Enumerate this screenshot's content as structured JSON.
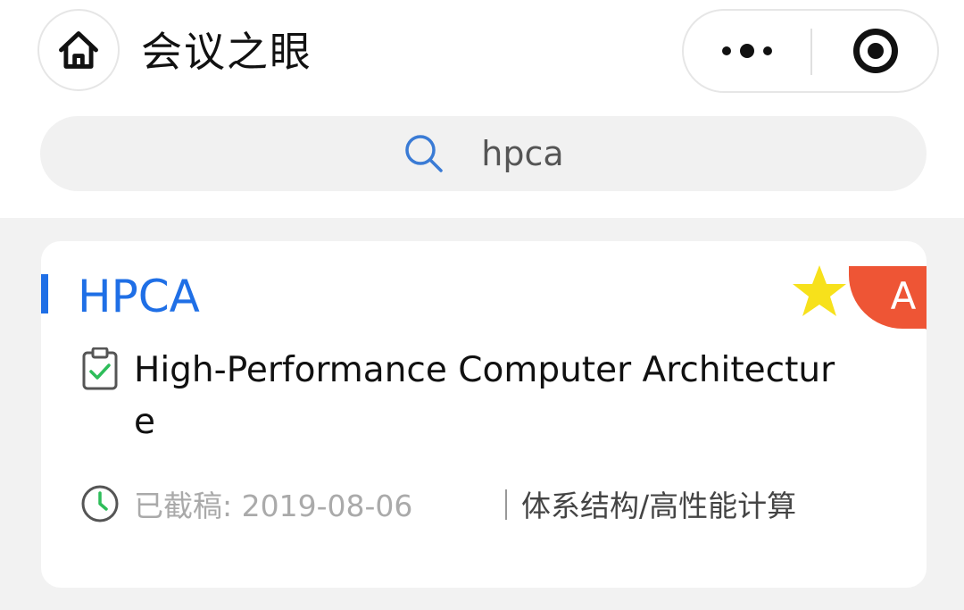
{
  "header": {
    "title": "会议之眼",
    "home_icon": "home-icon",
    "more_icon": "more-dots-icon",
    "close_icon": "target-circle-icon"
  },
  "search": {
    "icon": "search-icon",
    "query": "hpca",
    "icon_color": "#3a7bd5"
  },
  "conference": {
    "abbreviation": "HPCA",
    "full_name": "High-Performance Computer Architecture",
    "rank": "A",
    "favorite_icon": "star-icon",
    "deadline_label": "已截稿: 2019-08-06",
    "category": "体系结构/高性能计算"
  },
  "colors": {
    "accent": "#1f6fe6",
    "rank_badge": "#ee5535",
    "star": "#f7e11b",
    "check": "#2ebd5a"
  }
}
